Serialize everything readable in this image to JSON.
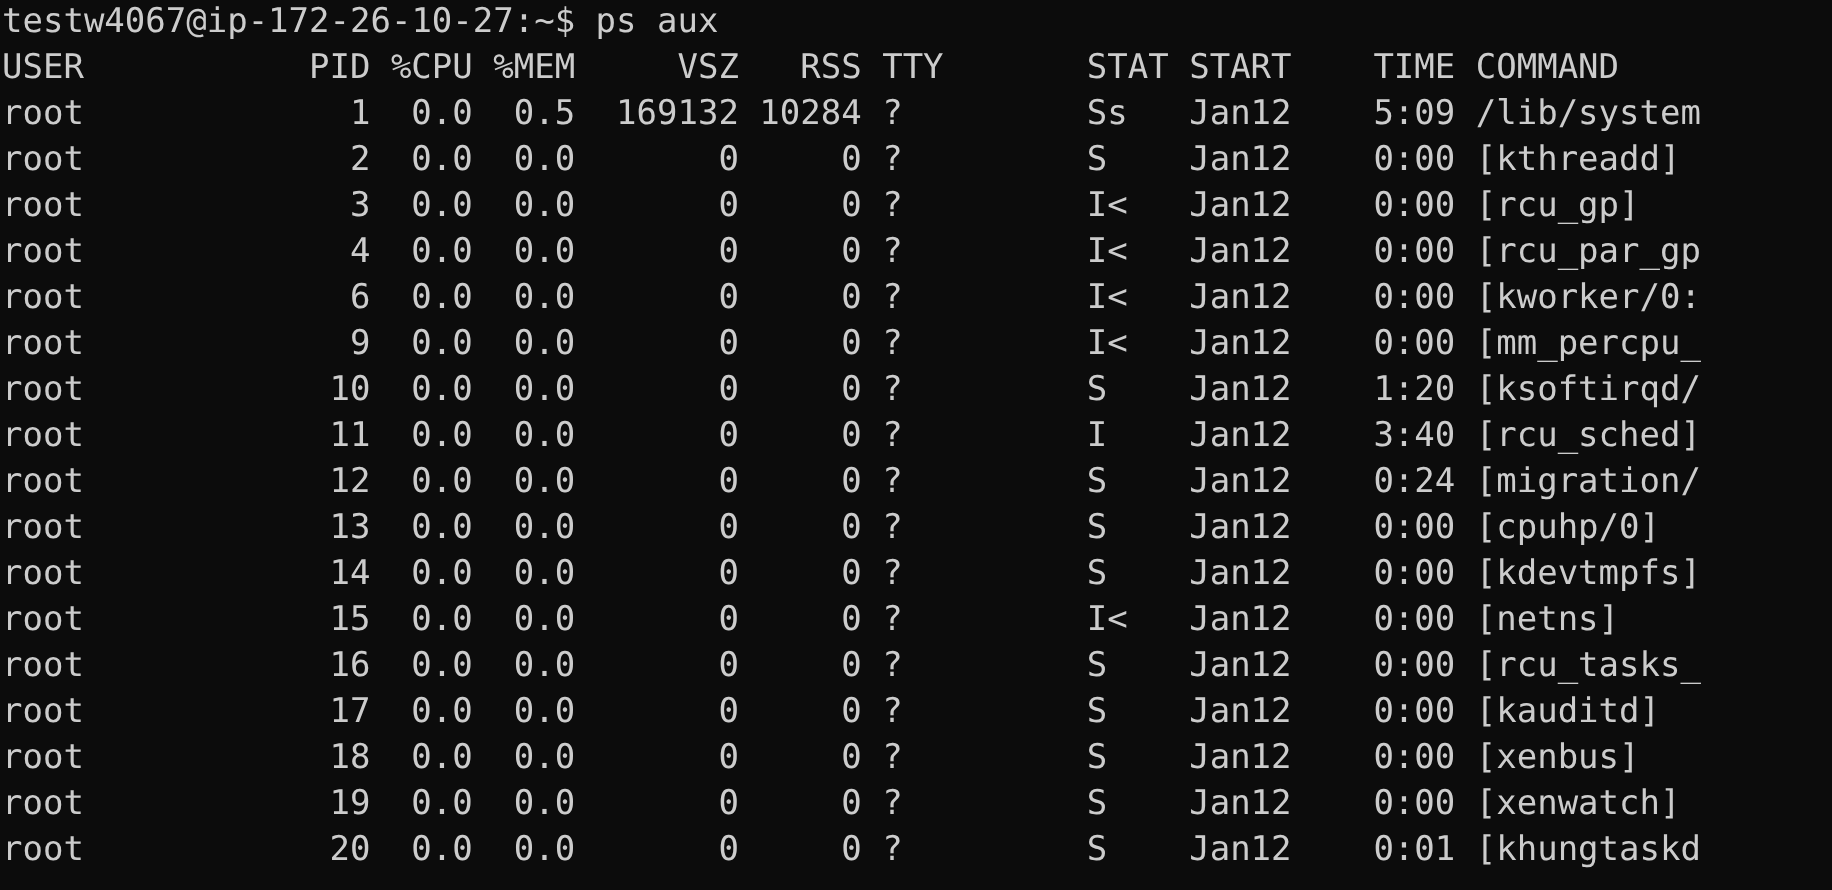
{
  "terminal": {
    "prompt_line": "testw4067@ip-172-26-10-27:~$ ps aux",
    "columns": [
      "USER",
      "PID",
      "%CPU",
      "%MEM",
      "VSZ",
      "RSS",
      "TTY",
      "STAT",
      "START",
      "TIME",
      "COMMAND"
    ],
    "rows": [
      [
        "root",
        "1",
        "0.0",
        "0.5",
        "169132",
        "10284",
        "?",
        "Ss",
        "Jan12",
        "5:09",
        "/lib/system"
      ],
      [
        "root",
        "2",
        "0.0",
        "0.0",
        "0",
        "0",
        "?",
        "S",
        "Jan12",
        "0:00",
        "[kthreadd]"
      ],
      [
        "root",
        "3",
        "0.0",
        "0.0",
        "0",
        "0",
        "?",
        "I<",
        "Jan12",
        "0:00",
        "[rcu_gp]"
      ],
      [
        "root",
        "4",
        "0.0",
        "0.0",
        "0",
        "0",
        "?",
        "I<",
        "Jan12",
        "0:00",
        "[rcu_par_gp"
      ],
      [
        "root",
        "6",
        "0.0",
        "0.0",
        "0",
        "0",
        "?",
        "I<",
        "Jan12",
        "0:00",
        "[kworker/0:"
      ],
      [
        "root",
        "9",
        "0.0",
        "0.0",
        "0",
        "0",
        "?",
        "I<",
        "Jan12",
        "0:00",
        "[mm_percpu_"
      ],
      [
        "root",
        "10",
        "0.0",
        "0.0",
        "0",
        "0",
        "?",
        "S",
        "Jan12",
        "1:20",
        "[ksoftirqd/"
      ],
      [
        "root",
        "11",
        "0.0",
        "0.0",
        "0",
        "0",
        "?",
        "I",
        "Jan12",
        "3:40",
        "[rcu_sched]"
      ],
      [
        "root",
        "12",
        "0.0",
        "0.0",
        "0",
        "0",
        "?",
        "S",
        "Jan12",
        "0:24",
        "[migration/"
      ],
      [
        "root",
        "13",
        "0.0",
        "0.0",
        "0",
        "0",
        "?",
        "S",
        "Jan12",
        "0:00",
        "[cpuhp/0]"
      ],
      [
        "root",
        "14",
        "0.0",
        "0.0",
        "0",
        "0",
        "?",
        "S",
        "Jan12",
        "0:00",
        "[kdevtmpfs]"
      ],
      [
        "root",
        "15",
        "0.0",
        "0.0",
        "0",
        "0",
        "?",
        "I<",
        "Jan12",
        "0:00",
        "[netns]"
      ],
      [
        "root",
        "16",
        "0.0",
        "0.0",
        "0",
        "0",
        "?",
        "S",
        "Jan12",
        "0:00",
        "[rcu_tasks_"
      ],
      [
        "root",
        "17",
        "0.0",
        "0.0",
        "0",
        "0",
        "?",
        "S",
        "Jan12",
        "0:00",
        "[kauditd]"
      ],
      [
        "root",
        "18",
        "0.0",
        "0.0",
        "0",
        "0",
        "?",
        "S",
        "Jan12",
        "0:00",
        "[xenbus]"
      ],
      [
        "root",
        "19",
        "0.0",
        "0.0",
        "0",
        "0",
        "?",
        "S",
        "Jan12",
        "0:00",
        "[xenwatch]"
      ],
      [
        "root",
        "20",
        "0.0",
        "0.0",
        "0",
        "0",
        "?",
        "S",
        "Jan12",
        "0:01",
        "[khungtaskd"
      ]
    ]
  }
}
